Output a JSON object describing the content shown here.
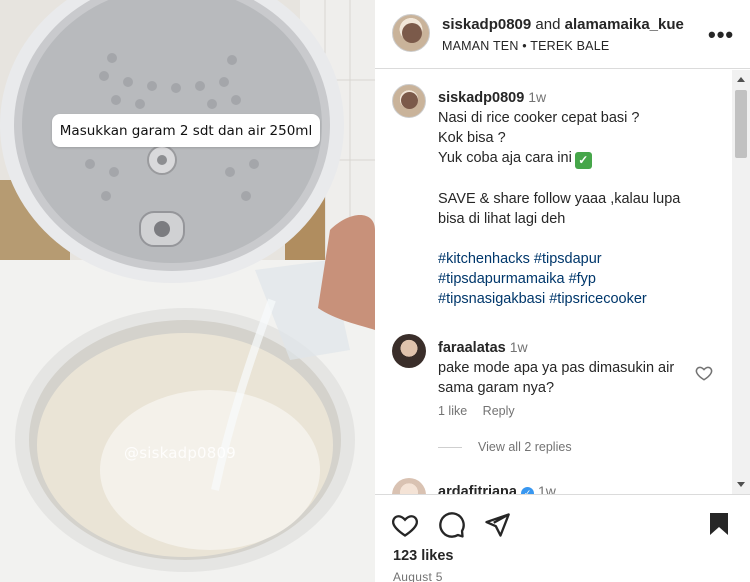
{
  "media": {
    "overlay_caption": "Masukkan garam 2 sdt dan air 250ml",
    "watermark": "@siskadp0809"
  },
  "header": {
    "user1": "siskadp0809",
    "and": "and",
    "user2": "alamamaika_kue",
    "subtitle": "MAMAN TEN • TEREK BALE",
    "more": "•••"
  },
  "post": {
    "username": "siskadp0809",
    "time": "1w",
    "lines": [
      "Nasi di rice cooker cepat basi ?",
      "Kok bisa ?",
      "Yuk coba aja cara ini",
      "SAVE & share follow yaaa ,kalau lupa",
      "bisa di lihat lagi deh"
    ],
    "check_glyph": "✓",
    "hashtags": [
      "#kitchenhacks #tipsdapur",
      "#tipsdapurmamaika #fyp",
      "#tipsnasigakbasi #tipsricecooker"
    ]
  },
  "comments": [
    {
      "username": "faraalatas",
      "time": "1w",
      "text": "pake mode apa ya pas dimasukin air sama garam nya?",
      "likes": "1 like",
      "reply": "Reply",
      "view_replies": "View all 2 replies"
    },
    {
      "username": "ardafitriana",
      "verified_glyph": "✓",
      "time": "1w"
    }
  ],
  "footer": {
    "likes": "123 likes",
    "date": "August 5"
  },
  "colors": {
    "link": "#00376b",
    "muted": "#737373",
    "verified": "#3897f0",
    "check": "#46a64a"
  },
  "icons": [
    "heart-icon",
    "comment-icon",
    "share-icon",
    "bookmark-icon",
    "more-options-icon"
  ]
}
